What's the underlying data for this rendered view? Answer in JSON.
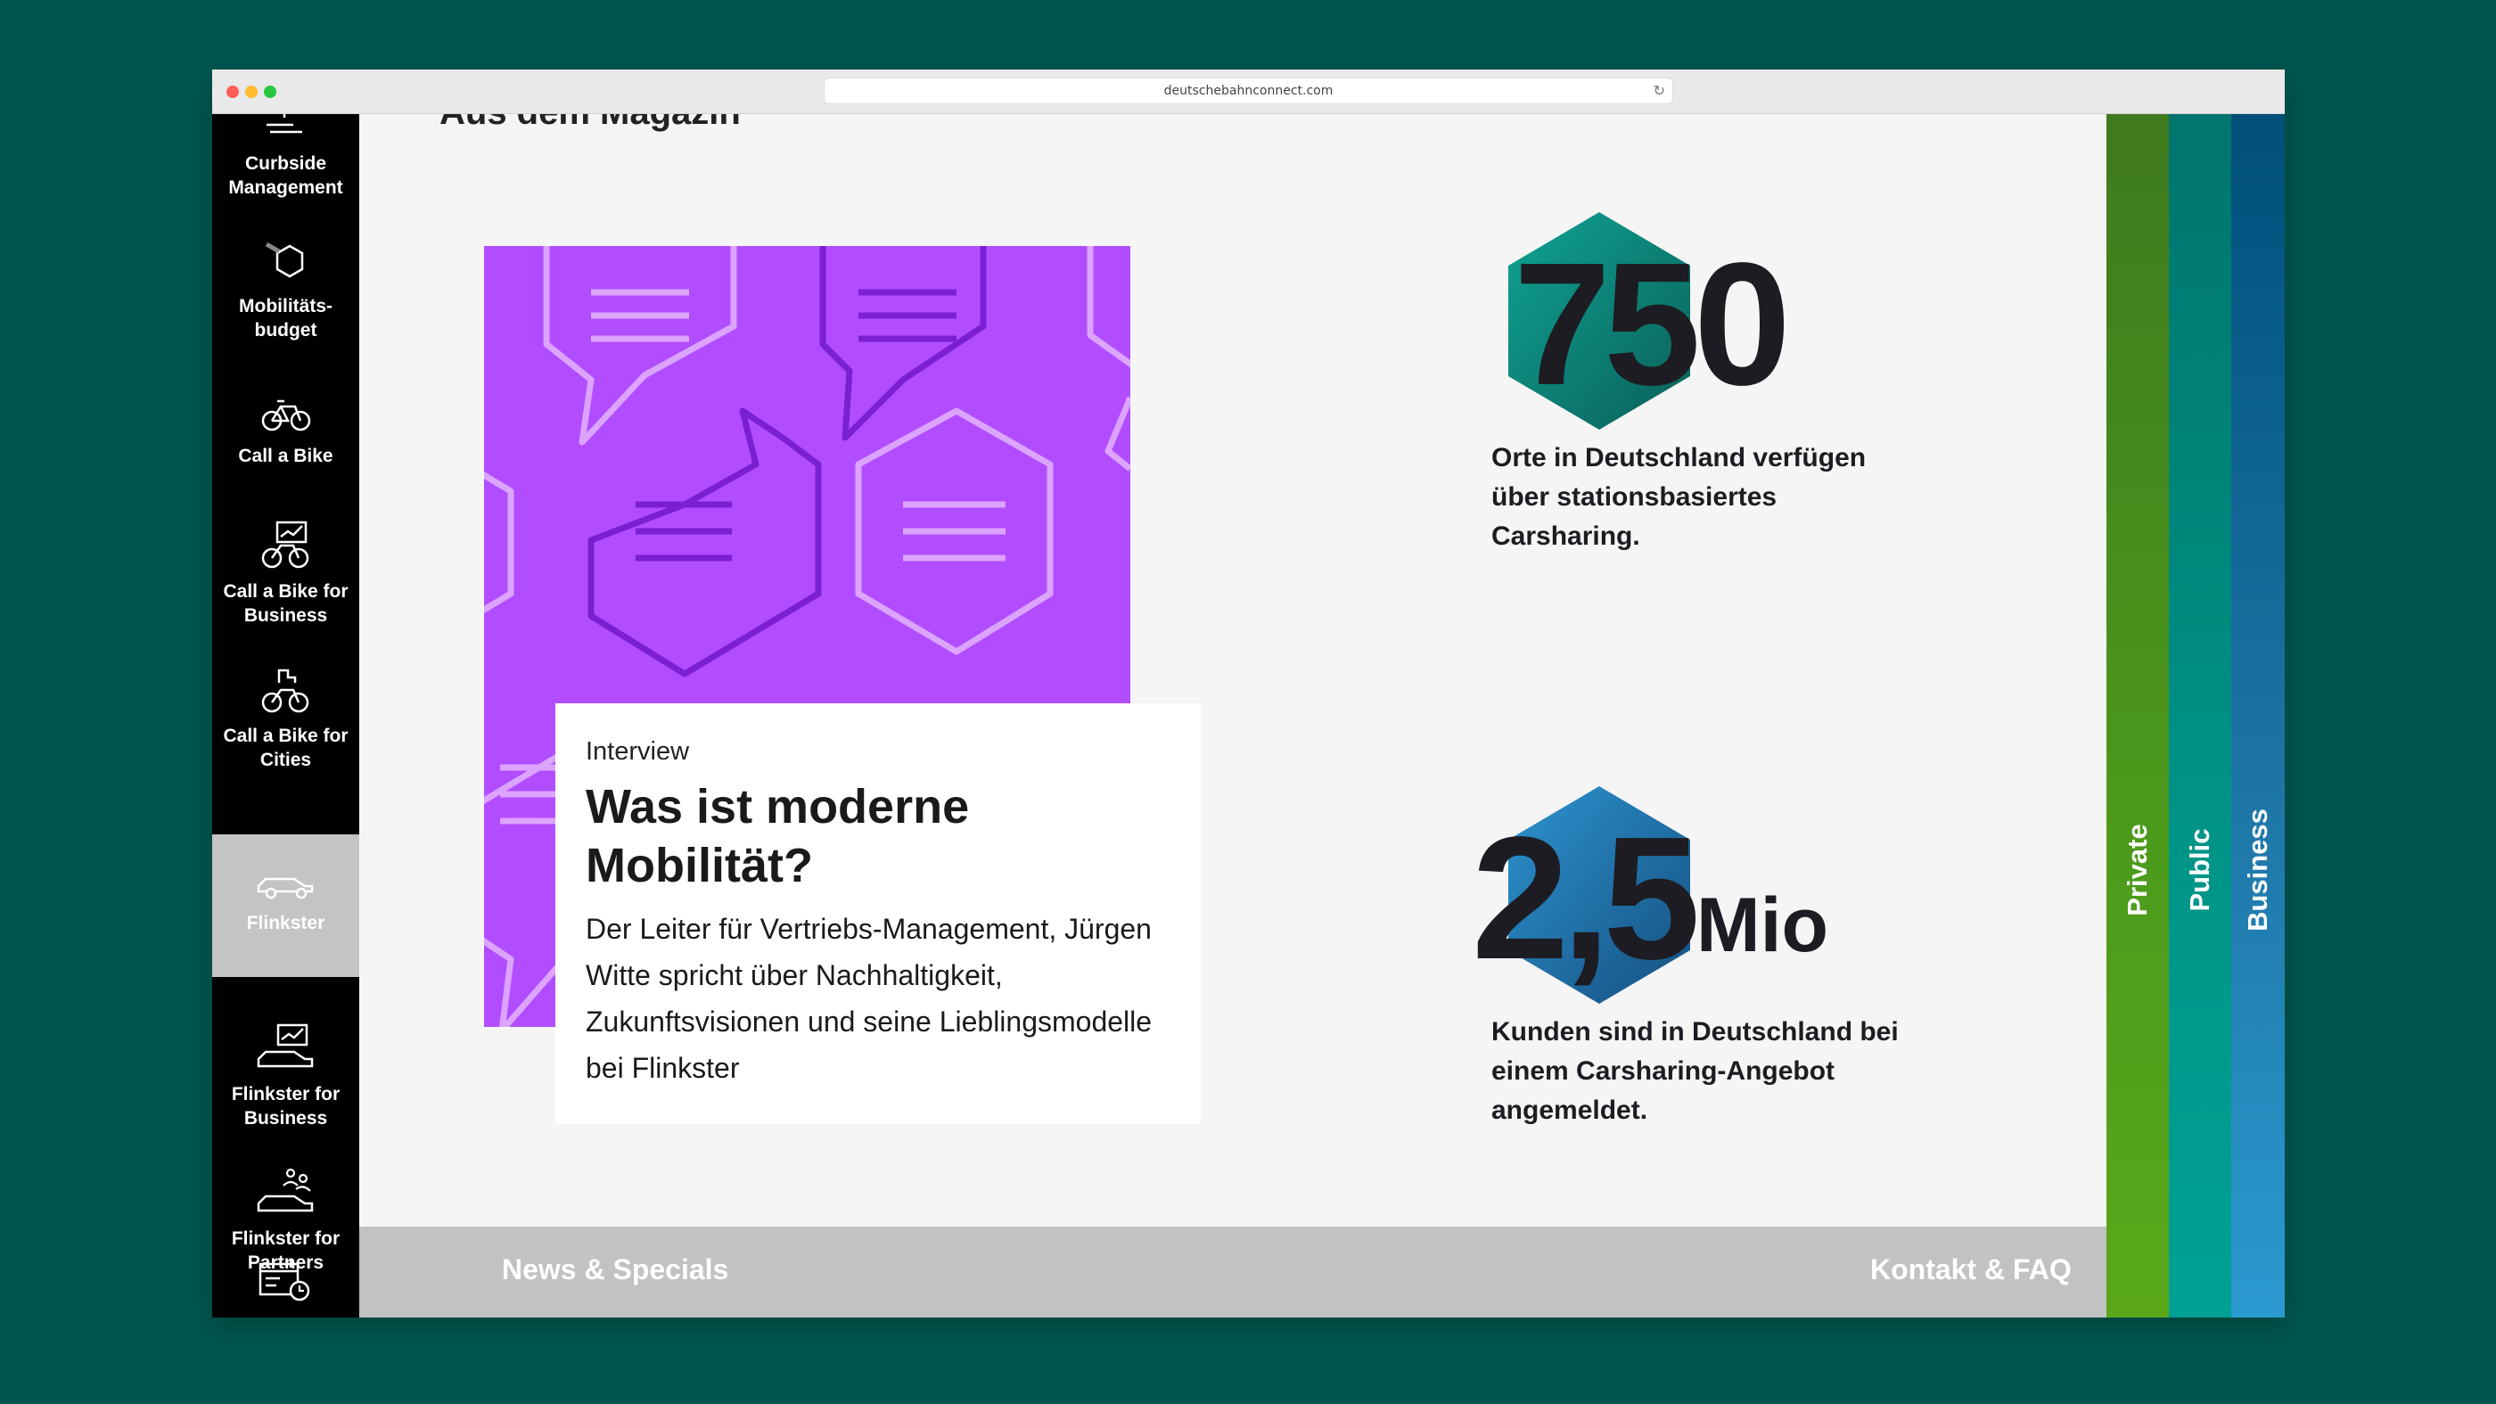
{
  "browser": {
    "url": "deutschebahnconnect.com"
  },
  "sidebar": {
    "items": [
      {
        "label": "Curbside\nManagement",
        "icon": "curbside-icon"
      },
      {
        "label": "Mobilitäts-\nbudget",
        "icon": "hexagon-icon"
      },
      {
        "label": "Call a Bike",
        "icon": "bike-icon"
      },
      {
        "label": "Call a Bike for\nBusiness",
        "icon": "bike-business-icon"
      },
      {
        "label": "Call a Bike for\nCities",
        "icon": "bike-cities-icon"
      },
      {
        "label": "Flinkster",
        "icon": "car-icon",
        "active": true
      },
      {
        "label": "Flinkster for\nBusiness",
        "icon": "car-business-icon"
      },
      {
        "label": "Flinkster for\nPartners",
        "icon": "car-partners-icon"
      },
      {
        "label": "",
        "icon": "calendar-clock-icon"
      }
    ]
  },
  "main": {
    "section_heading": "Aus dem Magazin",
    "article": {
      "kicker": "Interview",
      "title": "Was ist moderne Mobilität?",
      "text": "Der Leiter für Vertriebs-Management, Jürgen Witte spricht über Nachhaltigkeit, Zukunftsvisionen und seine Lieblingsmodelle bei Flinkster",
      "image_color": "#b14dff"
    },
    "stats": [
      {
        "number": "750",
        "unit": "",
        "description": "Orte in Deutschland verfügen über stationsbasiertes Carsharing.",
        "hex_color": "#0b8a7c"
      },
      {
        "number": "2,5",
        "unit": "Mio",
        "description": "Kunden sind in Deutschland bei einem Carsharing-Angebot angemeldet.",
        "hex_color": "#1f6fa6"
      }
    ]
  },
  "footer": {
    "left_link": "News & Specials",
    "right_link": "Kontakt & FAQ"
  },
  "tabs": [
    {
      "label": "Private",
      "color": "#4a8c1c"
    },
    {
      "label": "Public",
      "color": "#008a80"
    },
    {
      "label": "Business",
      "color": "#1e6fa0"
    }
  ]
}
